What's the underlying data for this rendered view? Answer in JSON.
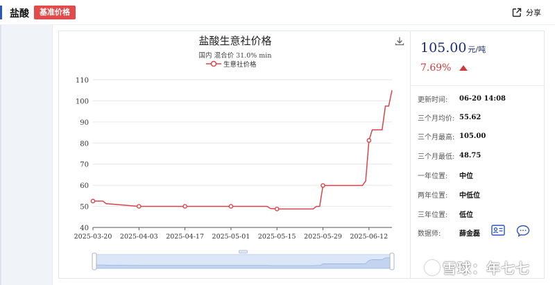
{
  "header": {
    "title": "盐酸",
    "badge": "基准价格",
    "share_label": "分享"
  },
  "colors": {
    "accent": "#2a55c8",
    "badge": "#e14b4b",
    "line": "#d9444a",
    "up": "#d23a3a",
    "price": "#1d2c7a"
  },
  "chart_data": {
    "type": "line",
    "title": "盐酸生意社价格",
    "subtitle": "国内 混合价 31.0% min",
    "legend": "生意社价格",
    "legend_position": "top-center",
    "series": [
      {
        "name": "生意社价格",
        "points": [
          [
            "2025-03-20",
            52.5
          ],
          [
            "2025-03-23",
            52.5
          ],
          [
            "2025-03-24",
            51.3
          ],
          [
            "2025-04-03",
            50
          ],
          [
            "2025-04-17",
            50
          ],
          [
            "2025-05-01",
            50
          ],
          [
            "2025-05-12",
            50
          ],
          [
            "2025-05-13",
            49
          ],
          [
            "2025-05-15",
            48.75
          ],
          [
            "2025-05-26",
            48.75
          ],
          [
            "2025-05-27",
            50
          ],
          [
            "2025-05-28",
            50
          ],
          [
            "2025-05-29",
            59.88
          ],
          [
            "2025-06-10",
            59.88
          ],
          [
            "2025-06-11",
            62
          ],
          [
            "2025-06-12",
            81.25
          ],
          [
            "2025-06-13",
            86.25
          ],
          [
            "2025-06-16",
            86.25
          ],
          [
            "2025-06-17",
            97.5
          ],
          [
            "2025-06-18",
            97.5
          ],
          [
            "2025-06-19",
            105
          ]
        ],
        "markers": [
          "2025-03-20",
          "2025-04-03",
          "2025-04-17",
          "2025-05-01",
          "2025-05-15",
          "2025-05-29",
          "2025-06-12"
        ]
      }
    ],
    "x_ticks": [
      "2025-03-20",
      "2025-04-03",
      "2025-04-17",
      "2025-05-01",
      "2025-05-15",
      "2025-05-29",
      "2025-06-12"
    ],
    "xlim": [
      "2025-03-20",
      "2025-06-19"
    ],
    "y_ticks": [
      40,
      50,
      60,
      70,
      80,
      90,
      100,
      110
    ],
    "ylim": [
      40,
      110
    ],
    "grid": true,
    "has_zoom_slider": true
  },
  "info": {
    "price": "105.00",
    "unit": "元/吨",
    "change": "7.69%",
    "rows": [
      {
        "k": "更新时间:",
        "v": "06-20 14:08"
      },
      {
        "k": "三个月均价:",
        "v": "55.62"
      },
      {
        "k": "三个月最高:",
        "v": "105.00"
      },
      {
        "k": "三个月最低:",
        "v": "48.75"
      },
      {
        "k": "一年位置:",
        "v": "中位"
      },
      {
        "k": "两年位置:",
        "v": "中低位"
      },
      {
        "k": "三年位置:",
        "v": "低位"
      },
      {
        "k": "数据师:",
        "v": "薛金磊"
      }
    ]
  },
  "watermark": {
    "text": "雪球：年七七"
  }
}
